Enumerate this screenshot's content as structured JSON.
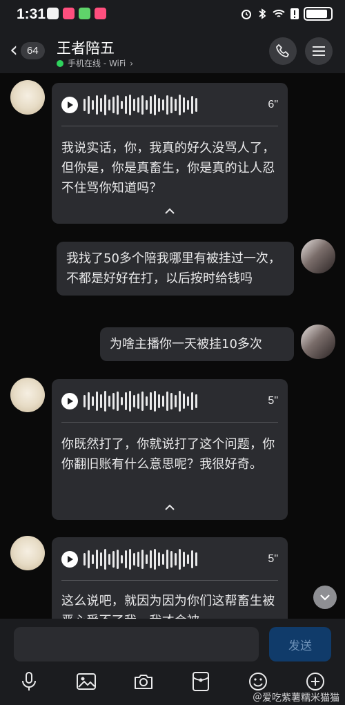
{
  "status_bar": {
    "time": "1:31"
  },
  "header": {
    "back_badge": "64",
    "contact_name": "王者陪五",
    "contact_status": "手机在线 - WiFi",
    "status_chevron": "›"
  },
  "messages": [
    {
      "type": "voice",
      "direction": "in",
      "duration": "6\"",
      "transcript": "我说实话，你，我真的好久没骂人了，但你是，你是真畜生，你是真的让人忍不住骂你知道吗？"
    },
    {
      "type": "text",
      "direction": "out",
      "text": "我找了50多个陪我哪里有被挂过一次，不都是好好在打，以后按时给钱吗"
    },
    {
      "type": "text",
      "direction": "out",
      "text": "为啥主播你一天被挂10多次"
    },
    {
      "type": "voice",
      "direction": "in",
      "duration": "5\"",
      "transcript": "你既然打了，你就说打了这个问题，你你翻旧账有什么意思呢？我很好奇。"
    },
    {
      "type": "voice",
      "direction": "in",
      "duration": "5\"",
      "transcript": "这么说吧，就因为因为你们这帮畜生被恶心受不了我，我才会被"
    }
  ],
  "input": {
    "send_label": "发送",
    "value": ""
  },
  "toolbar": {
    "icons": [
      "microphone-icon",
      "image-icon",
      "camera-icon",
      "red-packet-icon",
      "emoji-icon",
      "plus-icon"
    ]
  },
  "watermark": "＠爱吃紫薯糯米猫猫",
  "colors": {
    "online": "#2fd35d",
    "send_button": "#103b6a",
    "background": "#0a0a0a",
    "card": "#2b2c30"
  }
}
